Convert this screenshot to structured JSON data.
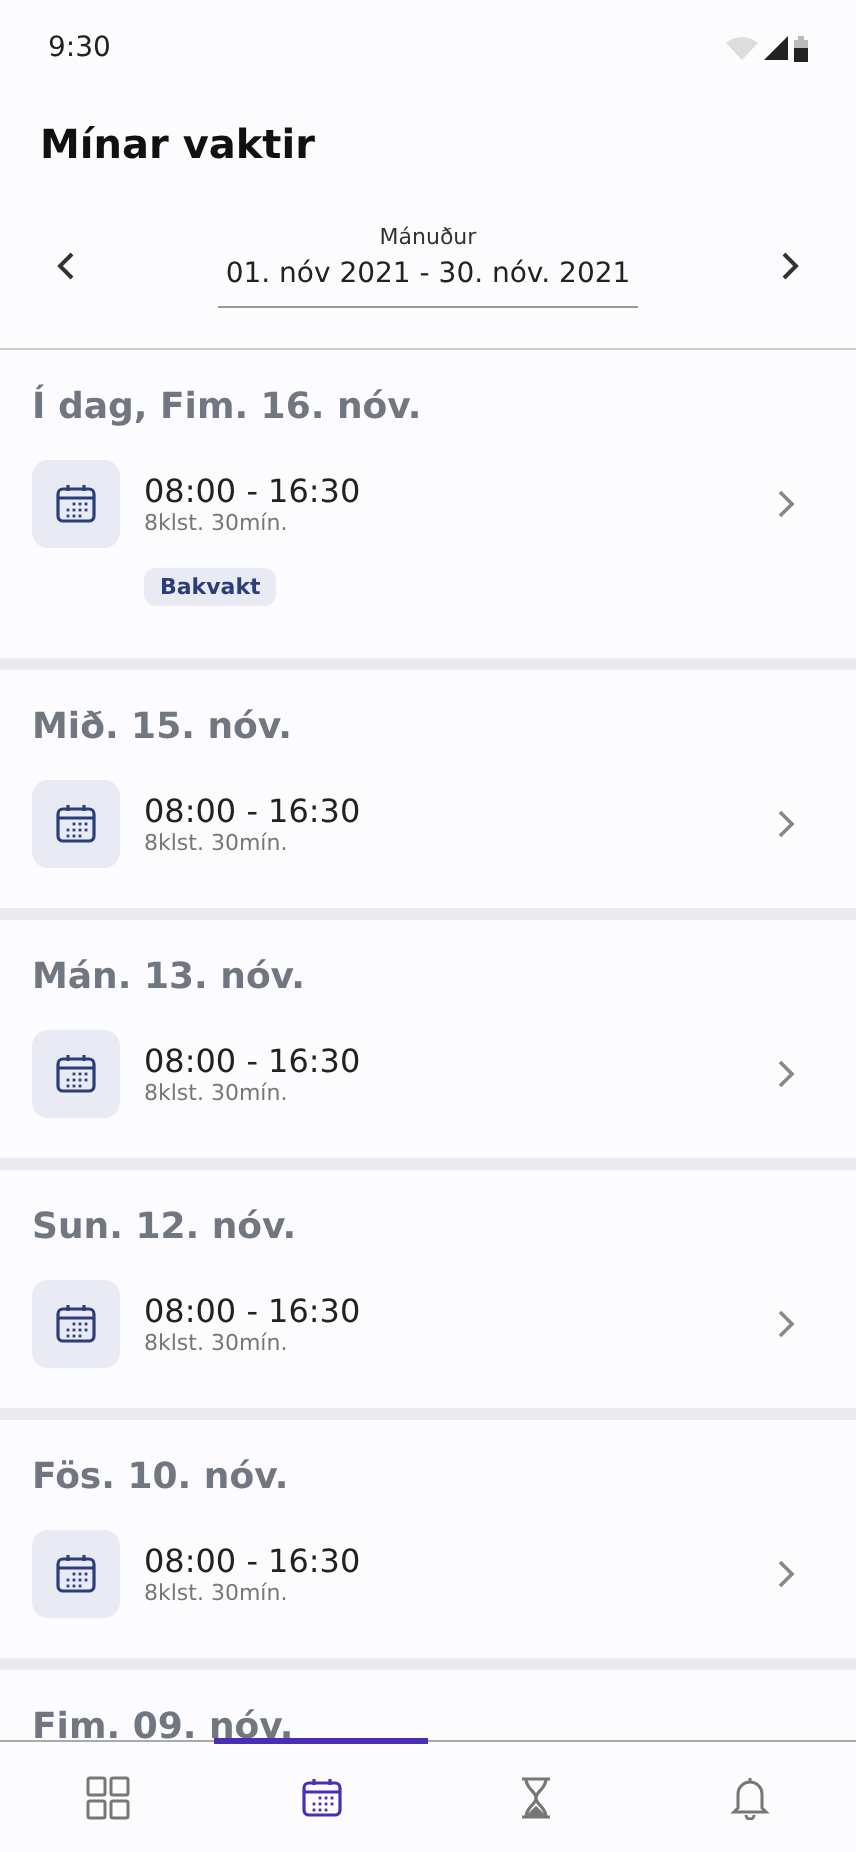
{
  "status_bar": {
    "time": "9:30"
  },
  "title": "Mínar vaktir",
  "period": {
    "label": "Mánuður",
    "range": "01. nóv 2021 - 30. nóv. 2021"
  },
  "days": [
    {
      "date": "Í dag, Fim. 16. nóv.",
      "shifts": [
        {
          "time": "08:00 - 16:30",
          "duration": "8klst. 30mín.",
          "tags": [
            "Bakvakt"
          ]
        }
      ]
    },
    {
      "date": "Mið. 15. nóv.",
      "shifts": [
        {
          "time": "08:00 - 16:30",
          "duration": "8klst. 30mín."
        }
      ]
    },
    {
      "date": "Mán. 13. nóv.",
      "shifts": [
        {
          "time": "08:00 - 16:30",
          "duration": "8klst. 30mín."
        }
      ]
    },
    {
      "date": "Sun. 12. nóv.",
      "shifts": [
        {
          "time": "08:00 - 16:30",
          "duration": "8klst. 30mín."
        }
      ]
    },
    {
      "date": "Fös. 10. nóv.",
      "shifts": [
        {
          "time": "08:00 - 16:30",
          "duration": "8klst. 30mín."
        }
      ]
    },
    {
      "date": "Fim. 09. nóv."
    }
  ],
  "nav": [
    {
      "kind": "grid",
      "selected": false
    },
    {
      "kind": "calendar",
      "selected": true
    },
    {
      "kind": "hourglass",
      "selected": false
    },
    {
      "kind": "bell",
      "selected": false
    }
  ]
}
